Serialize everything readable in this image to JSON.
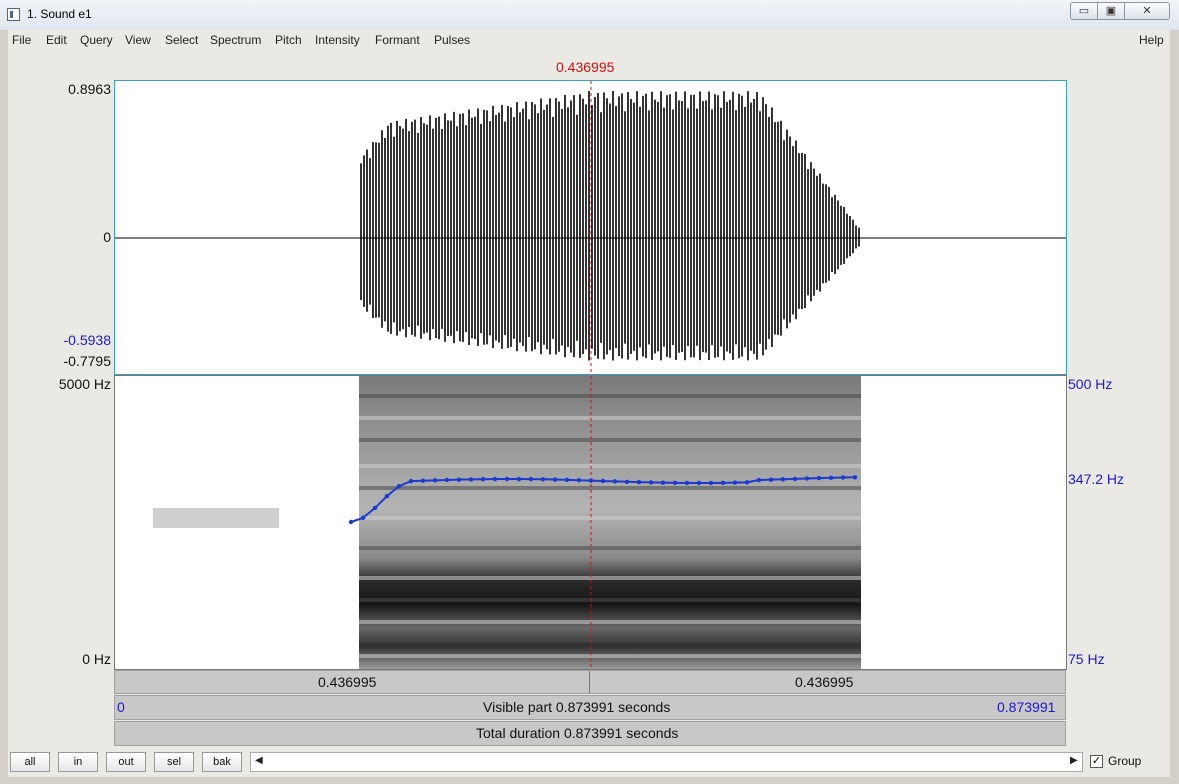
{
  "window": {
    "title": "1. Sound e1",
    "controls": {
      "minimize": "▭",
      "maximize": "▣",
      "close": "✕"
    }
  },
  "menu": [
    "File",
    "Edit",
    "Query",
    "View",
    "Select",
    "Spectrum",
    "Pitch",
    "Intensity",
    "Formant",
    "Pulses"
  ],
  "help": "Help",
  "cursor_time": "0.436995",
  "waveform": {
    "ymax": "0.8963",
    "zero": "0",
    "cursor_value": "-0.5938",
    "ymin": "-0.7795"
  },
  "spectrogram": {
    "fmax": "5000 Hz",
    "fmin": "0 Hz",
    "pitch_max": "500 Hz",
    "pitch_cursor": "347.2 Hz",
    "pitch_min": "75 Hz"
  },
  "time_bar": {
    "left": "0.436995",
    "right": "0.436995"
  },
  "visible_bar": {
    "start": "0",
    "label": "Visible part 0.873991 seconds",
    "end": "0.873991"
  },
  "total_bar": {
    "label": "Total duration 0.873991 seconds"
  },
  "buttons": {
    "all": "all",
    "in": "in",
    "out": "out",
    "sel": "sel",
    "bak": "bak"
  },
  "scroll": {
    "left": "◀",
    "right": "▶"
  },
  "group": {
    "label": "Group",
    "checked": "✓"
  },
  "colors": {
    "cursor": "#d01010",
    "pitch": "#1a1ad0"
  }
}
